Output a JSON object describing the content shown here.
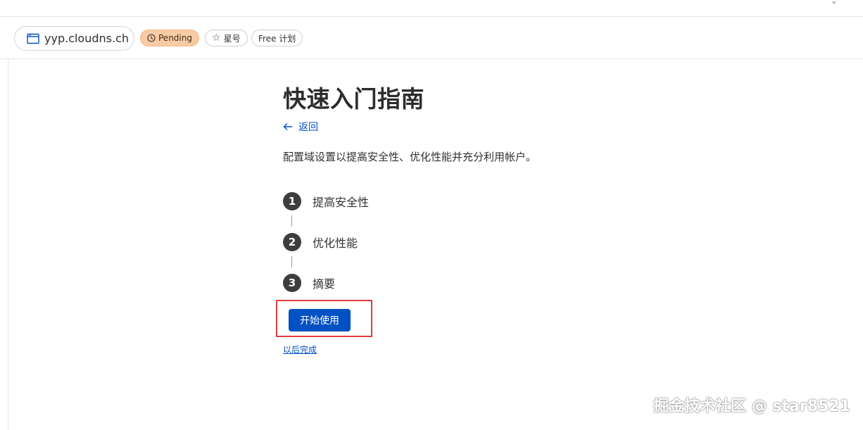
{
  "domain_bar": {
    "domain": "yyp.cloudns.ch",
    "status": "Pending",
    "star_label": "星号",
    "plan": "Free 计划"
  },
  "guide": {
    "title": "快速入门指南",
    "back_label": "返回",
    "description": "配置域设置以提高安全性、优化性能并充分利用帐户。",
    "steps": [
      {
        "number": "1",
        "label": "提高安全性"
      },
      {
        "number": "2",
        "label": "优化性能"
      },
      {
        "number": "3",
        "label": "摘要"
      }
    ],
    "start_button": "开始使用",
    "later_link": "以后完成"
  },
  "watermark": "掘金技术社区 @ star8521",
  "colors": {
    "accent": "#0051c3",
    "pending_bg": "#f9cba4",
    "highlight": "#e03c3c",
    "step_circle": "#3d3d3d"
  }
}
